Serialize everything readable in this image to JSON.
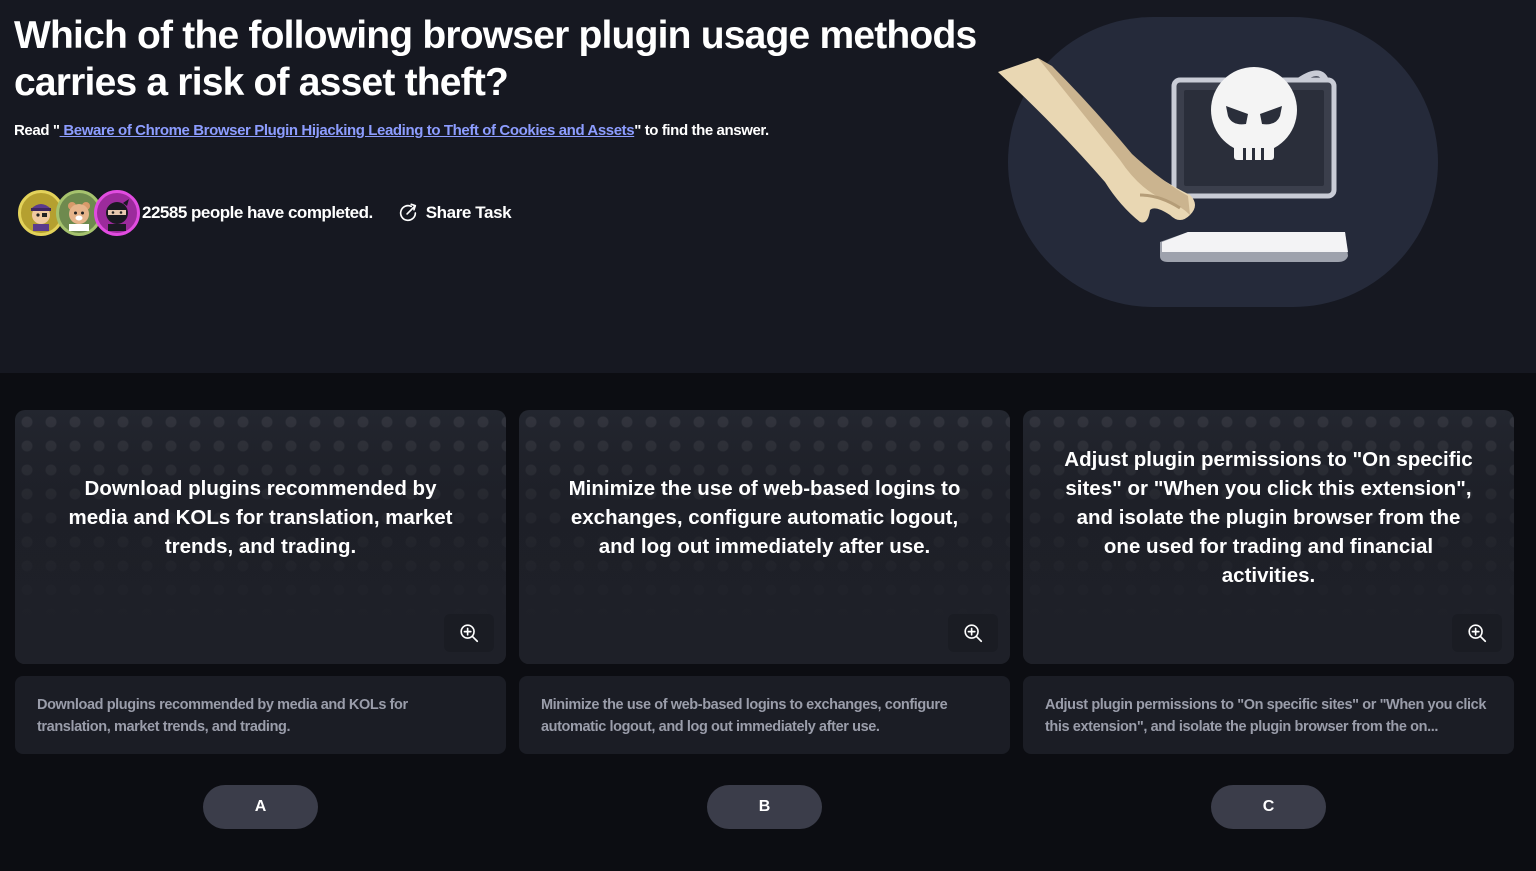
{
  "question": {
    "title": "Which of the following browser plugin usage methods carries a risk of asset theft?",
    "read_prefix": "Read \"",
    "read_link": " Beware of Chrome Browser Plugin Hijacking Leading to Theft of Cookies and Assets",
    "read_suffix": "\" to find the answer."
  },
  "meta": {
    "completed_text": "22585 people have completed.",
    "share_label": "Share Task",
    "avatar_icons": [
      "pirate-avatar-icon",
      "bear-avatar-icon",
      "ninja-avatar-icon"
    ]
  },
  "options": [
    {
      "letter": "A",
      "card_text": "Download plugins recommended by media and KOLs for translation, market trends, and trading.",
      "desc": "Download plugins recommended by media and KOLs for translation, market trends, and trading."
    },
    {
      "letter": "B",
      "card_text": "Minimize the use of web-based logins to exchanges, configure automatic logout, and log out immediately after use.",
      "desc": "Minimize the use of web-based logins to exchanges, configure automatic logout, and log out immediately after use."
    },
    {
      "letter": "C",
      "card_text": "Adjust plugin permissions to \"On specific sites\" or \"When you click this extension\", and isolate the plugin browser from the one used for trading and financial activities.",
      "desc": "Adjust plugin permissions to \"On specific sites\" or \"When you click this extension\", and isolate the plugin browser from the on..."
    }
  ],
  "colors": {
    "page_bg": "#0c0d12",
    "hero_bg": "#161821",
    "link": "#8d9dff",
    "button_bg": "#3b3d4a",
    "desc_text": "#9a9daa"
  }
}
